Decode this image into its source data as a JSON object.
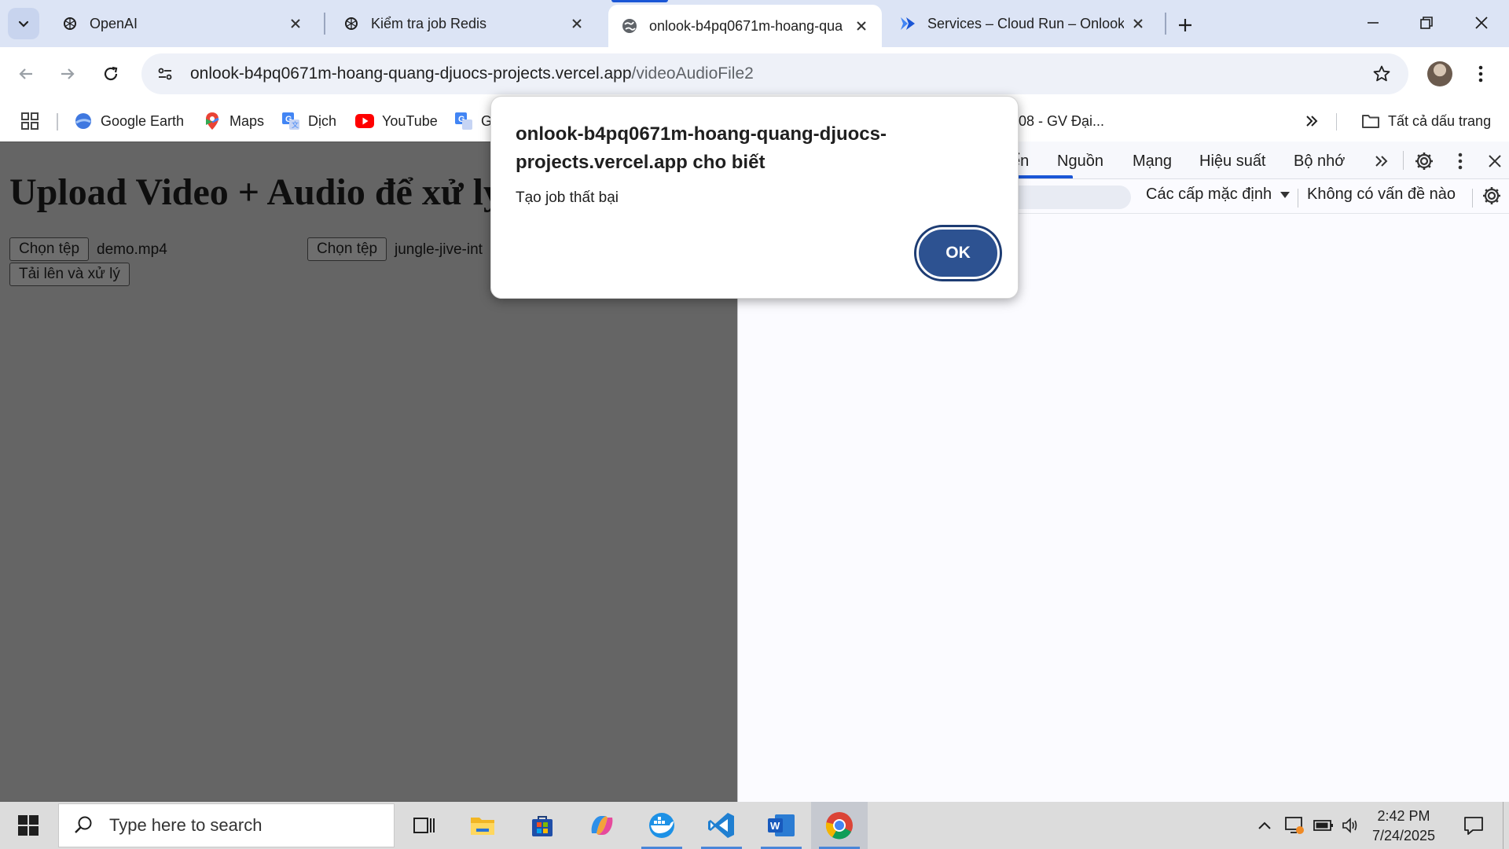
{
  "browser": {
    "tabs": [
      {
        "title": "OpenAI",
        "favicon": "openai-icon"
      },
      {
        "title": "Kiểm tra job Redis",
        "favicon": "openai-icon"
      },
      {
        "title": "onlook-b4pq0671m-hoang-qua",
        "favicon": "globe-icon"
      },
      {
        "title": "Services – Cloud Run – Onlook",
        "favicon": "cloud-run-icon"
      }
    ],
    "active_tab_index": 2,
    "url": {
      "host": "onlook-b4pq0671m-hoang-quang-djuocs-projects.vercel.app",
      "path": "/videoAudioFile2"
    },
    "bookmarks": [
      {
        "label": "Google Earth",
        "icon": "google-earth-icon"
      },
      {
        "label": "Maps",
        "icon": "maps-pin-icon"
      },
      {
        "label": "Dịch",
        "icon": "translate-icon"
      },
      {
        "label": "YouTube",
        "icon": "youtube-icon"
      },
      {
        "label": "G",
        "icon": "translate-icon"
      },
      {
        "label": "08 - GV Đại...",
        "icon": ""
      }
    ],
    "all_bookmarks_label": "Tất cả dấu trang"
  },
  "page": {
    "heading": "Upload Video + Audio để xử lý",
    "file_inputs": [
      {
        "button_label": "Chọn tệp",
        "file_name": "demo.mp4"
      },
      {
        "button_label": "Chọn tệp",
        "file_name": "jungle-jive-int"
      }
    ],
    "submit_label": "Tải lên và xử lý"
  },
  "devtools": {
    "tabs": [
      "ển",
      "Nguồn",
      "Mạng",
      "Hiệu suất",
      "Bộ nhớ"
    ],
    "active_tab_index": 0,
    "levels_label": "Các cấp mặc định",
    "issues_label": "Không có vấn đề nào"
  },
  "dialog": {
    "title": "onlook-b4pq0671m-hoang-quang-djuocs-projects.vercel.app cho biết",
    "message": "Tạo job thất bại",
    "ok_label": "OK"
  },
  "taskbar": {
    "search_placeholder": "Type here to search",
    "apps": [
      "task-view-icon",
      "file-explorer-icon",
      "microsoft-store-icon",
      "copilot-icon",
      "docker-icon",
      "vscode-icon",
      "word-icon",
      "chrome-icon"
    ],
    "clock_time": "2:42 PM",
    "clock_date": "7/24/2025"
  },
  "colors": {
    "tabstrip_bg": "#dce4f5",
    "accent_blue": "#1a56d6",
    "dialog_ok_bg": "#2d5291",
    "page_overlay_bg": "#656565"
  }
}
